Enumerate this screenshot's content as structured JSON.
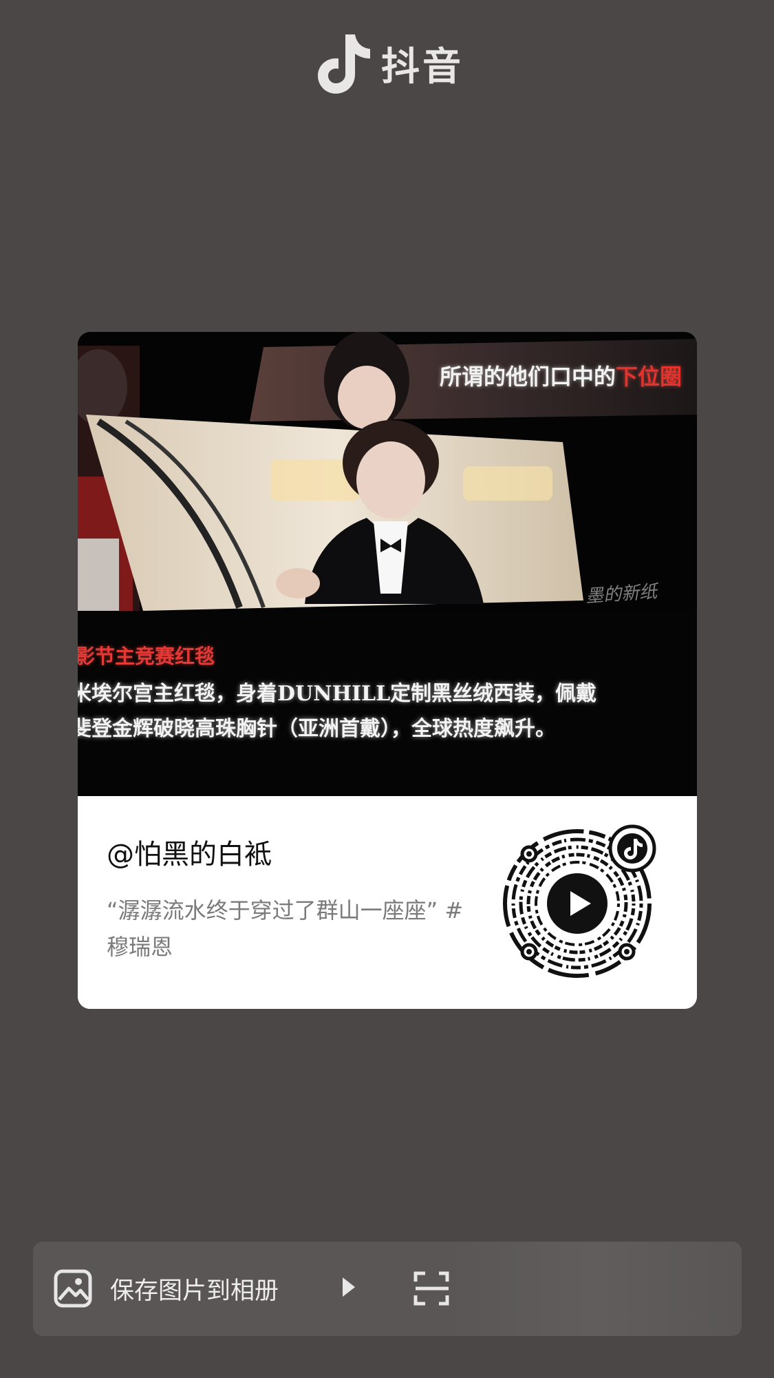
{
  "app": {
    "logo_text": "抖音"
  },
  "card": {
    "cover": {
      "headline_prefix": "所谓的他们口中的",
      "headline_highlight": "下位圈",
      "watermark": "墨的新纸",
      "caption_red": "影节主竞赛红毯",
      "caption_line1": "米埃尔宫主红毯，身着DUNHILL定制黑丝绒西装，佩戴",
      "caption_line2": "斐登金辉破晓高珠胸针（亚洲首戴），全球热度飙升。"
    },
    "author": "@怕黑的白袛",
    "description": "“潺潺流水终于穿过了群山一座座” #穆瑞恩"
  },
  "actions": {
    "save_label": "保存图片到相册"
  },
  "colors": {
    "accent_red": "#e5322a",
    "background": "#4a4746",
    "bar": "#595655"
  }
}
